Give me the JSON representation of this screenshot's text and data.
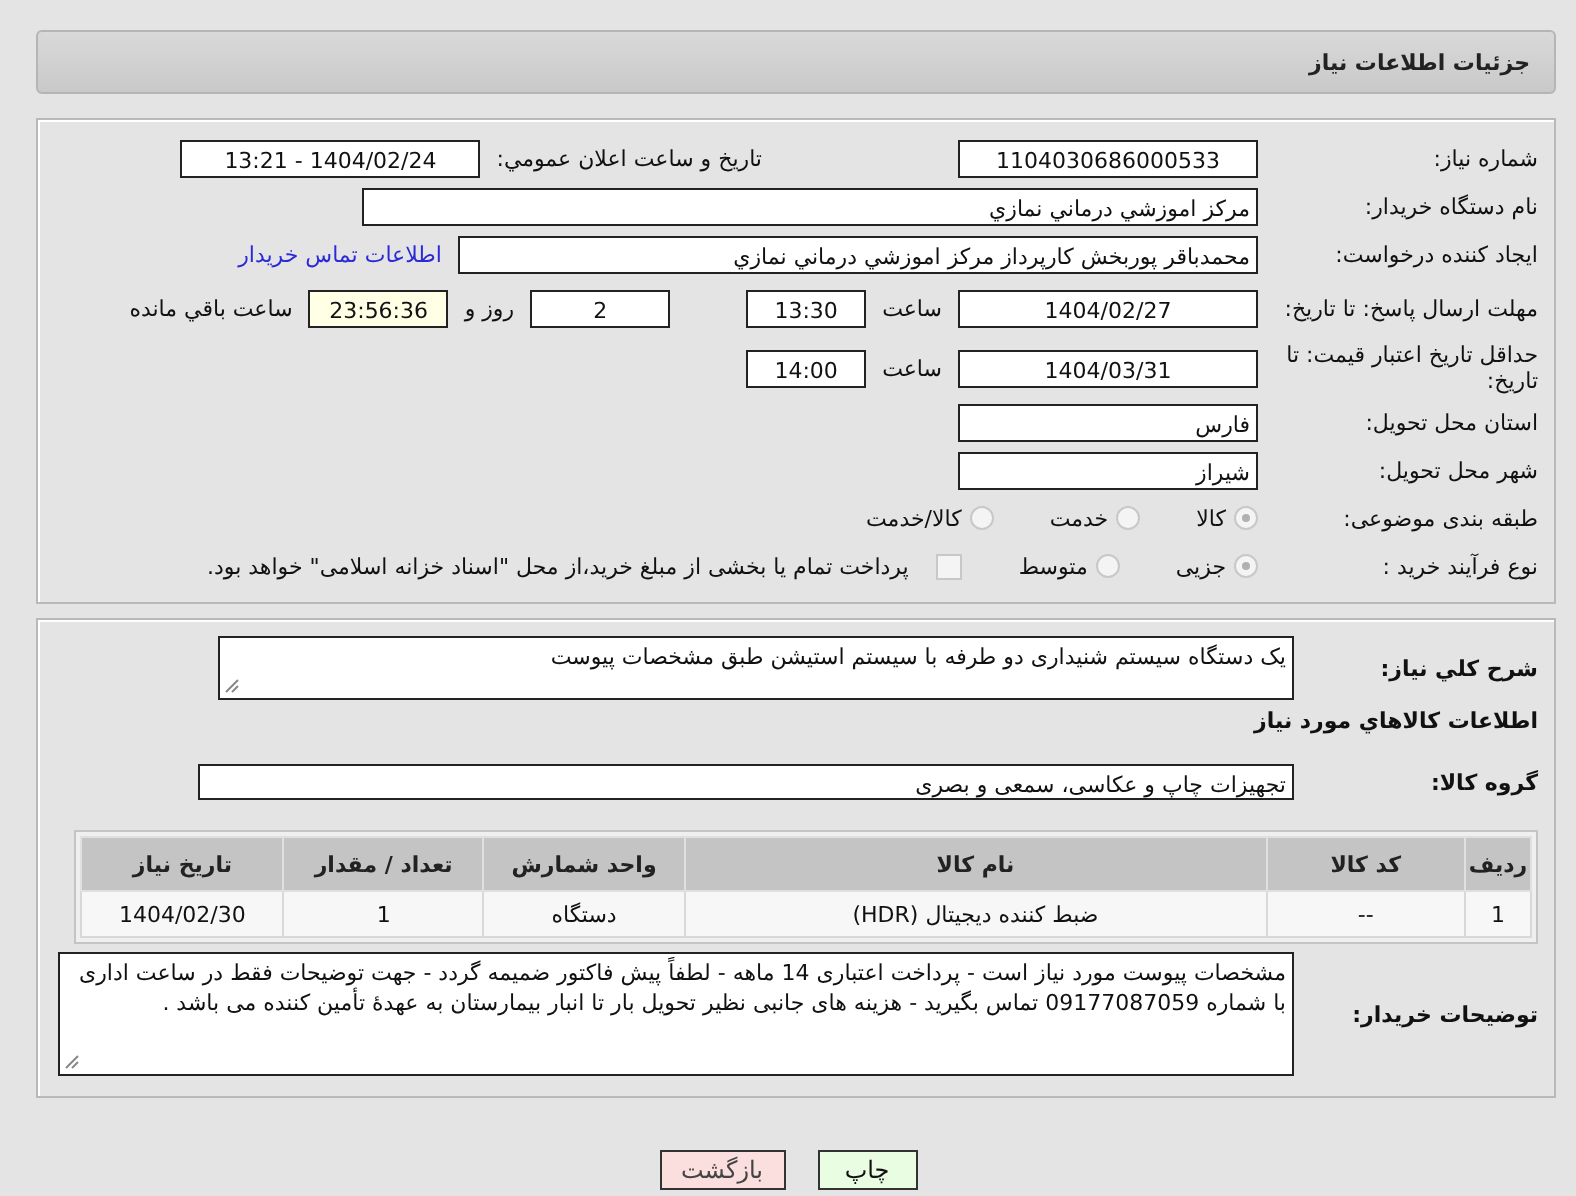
{
  "header": {
    "title": "جزئیات اطلاعات نیاز"
  },
  "need_number": {
    "label": "شماره نیاز:",
    "value": "1104030686000533"
  },
  "announce": {
    "label": "تاریخ و ساعت اعلان عمومي:",
    "value": "1404/02/24 - 13:21"
  },
  "buyer_org": {
    "label": "نام دستگاه خریدار:",
    "value": "مرکز اموزشي درماني نمازي"
  },
  "creator": {
    "label": "ایجاد کننده درخواست:",
    "value": "محمدباقر پوربخش کارپرداز مرکز اموزشي درماني نمازي",
    "link": "اطلاعات تماس خریدار"
  },
  "deadline": {
    "label": "مهلت ارسال پاسخ: تا تاریخ:",
    "date": "1404/02/27",
    "time_label": "ساعت",
    "time": "13:30",
    "days": "2",
    "days_label": "روز و",
    "remaining": "23:56:36",
    "remaining_label": "ساعت باقي مانده"
  },
  "validity": {
    "label": "حداقل تاریخ اعتبار قیمت: تا تاریخ:",
    "date": "1404/03/31",
    "time_label": "ساعت",
    "time": "14:00"
  },
  "province": {
    "label": "استان محل تحویل:",
    "value": "فارس"
  },
  "city": {
    "label": "شهر محل تحویل:",
    "value": "شیراز"
  },
  "category": {
    "label": "طبقه بندی موضوعی:",
    "options": [
      {
        "label": "کالا",
        "selected": true
      },
      {
        "label": "خدمت",
        "selected": false
      },
      {
        "label": "کالا/خدمت",
        "selected": false
      }
    ]
  },
  "purchase_type": {
    "label": "نوع فرآیند خرید :",
    "options": [
      {
        "label": "جزیی",
        "selected": true
      },
      {
        "label": "متوسط",
        "selected": false
      }
    ],
    "payment_note": {
      "label": "پرداخت تمام یا بخشی از مبلغ خرید،از محل \"اسناد خزانه اسلامی\" خواهد بود.",
      "checked": false
    }
  },
  "description": {
    "label": "شرح کلي نیاز:",
    "value": "یک دستگاه سیستم شنیداری دو طرفه با سیستم استیشن طبق مشخصات پیوست"
  },
  "goods_title": "اطلاعات کالاهاي مورد نیاز",
  "goods_group": {
    "label": "گروه کالا:",
    "value": "تجهیزات چاپ و عکاسی، سمعی و بصری"
  },
  "table": {
    "columns": [
      "ردیف",
      "کد کالا",
      "نام کالا",
      "واحد شمارش",
      "تعداد / مقدار",
      "تاریخ نیاز"
    ],
    "rows": [
      [
        "1",
        "--",
        "ضبط کننده دیجیتال (HDR)",
        "دستگاه",
        "1",
        "1404/02/30"
      ]
    ]
  },
  "buyer_notes": {
    "label": "توضیحات خریدار:",
    "value": "مشخصات پیوست مورد نیاز است - پرداخت اعتباری 14 ماهه - لطفاً پیش فاکتور ضمیمه گردد - جهت توضیحات فقط در ساعت اداری با شماره 09177087059 تماس بگیرید - هزینه های جانبی نظیر تحویل بار تا انبار بیمارستان به عهدهٔ تأمین کننده می باشد ."
  },
  "buttons": [
    {
      "label": "چاپ",
      "kind": "print"
    },
    {
      "label": "بازگشت",
      "kind": "back"
    }
  ]
}
